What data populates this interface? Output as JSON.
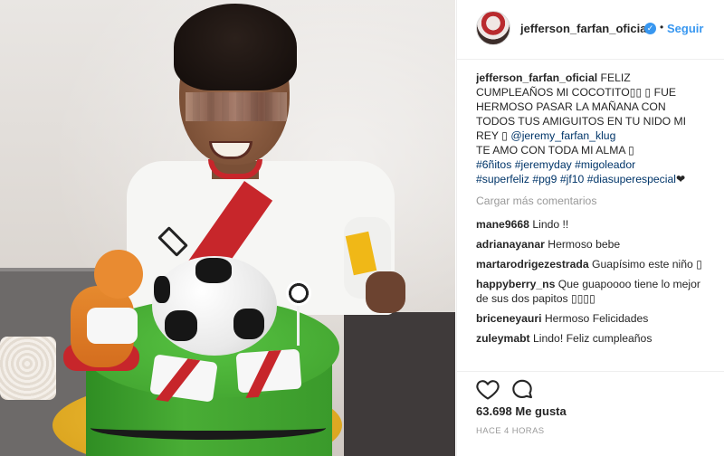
{
  "post": {
    "username": "jefferson_farfan_oficial",
    "verified_glyph": "✓",
    "separator": "•",
    "follow_label": "Seguir"
  },
  "caption": {
    "username": "jefferson_farfan_oficial",
    "line1": "FELIZ",
    "line2": "CUMPLEAÑOS MI COCOTITO▯▯ ▯ FUE",
    "line3": "HERMOSO PASAR LA MAÑANA CON",
    "line4": "TODOS TUS AMIGUITOS EN TU NIDO MI",
    "line5_prefix": "REY ▯",
    "mention": "@jeremy_farfan_klug",
    "line6": "TE AMO CON TODA MI ALMA ▯",
    "hashtags_line1": [
      "#6ñitos",
      "#jeremyday",
      "#migoleador"
    ],
    "hashtags_line2": [
      "#superfeliz",
      "#pg9",
      "#jf10",
      "#diasuperespecial"
    ],
    "heart_glyph": "❤"
  },
  "load_more_label": "Cargar más comentarios",
  "comments": [
    {
      "user": "mane9668",
      "text": "Lindo !!"
    },
    {
      "user": "adrianayanar",
      "text": "Hermoso bebe"
    },
    {
      "user": "martarodrigezestrada",
      "text": "Guapísimo este niño ▯"
    },
    {
      "user": "happyberry_ns",
      "text": "Que guapoooo tiene lo mejor de sus dos papitos ▯▯▯▯"
    },
    {
      "user": "briceneyauri",
      "text": "Hermoso Felicidades"
    },
    {
      "user": "zuleymabt",
      "text": "Lindo! Feliz cumpleaños"
    }
  ],
  "actions": {
    "like_icon": "heart-outline-icon",
    "comment_icon": "comment-bubble-icon"
  },
  "likes": {
    "count": "63.698",
    "label": "Me gusta"
  },
  "timestamp": "HACE 4 HORAS",
  "colors": {
    "link_blue": "#3897f0",
    "hashtag_blue": "#003569",
    "muted_gray": "#999999",
    "text": "#262626"
  }
}
